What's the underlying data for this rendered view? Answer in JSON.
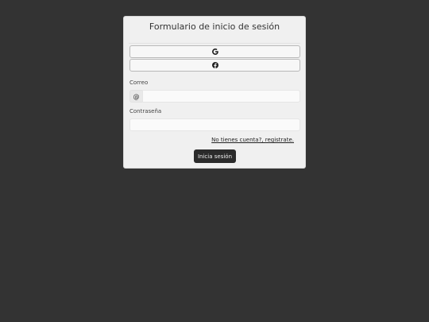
{
  "form": {
    "title": "Formulario de inicio de sesión",
    "social": [
      {
        "provider": "Google",
        "icon": "google-icon"
      },
      {
        "provider": "Facebook",
        "icon": "facebook-icon"
      }
    ],
    "email_label": "Correo",
    "email_addon": "@",
    "email_value": "",
    "password_label": "Contraseña",
    "password_value": "",
    "register_link": "No tienes cuenta?, registrate.",
    "submit_label": "Inicia sesión"
  },
  "colors": {
    "background": "#333333",
    "card": "#f0f0f0",
    "button": "#2b2b2b"
  }
}
